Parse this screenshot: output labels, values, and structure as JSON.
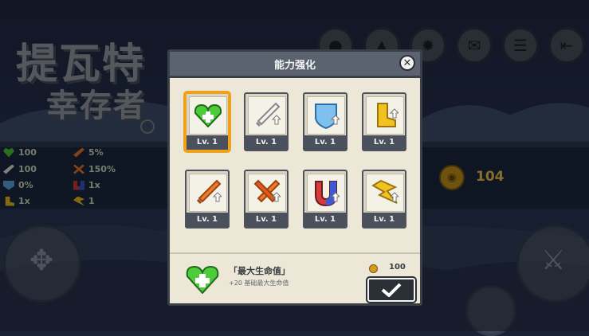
{
  "logo": {
    "line1": "提瓦特",
    "line2": "幸存者"
  },
  "top_icons": [
    "avatar-icon",
    "upload-icon",
    "gear-icon",
    "mail-icon",
    "list-icon",
    "exit-icon"
  ],
  "stats": [
    {
      "icon": "heart-icon",
      "value": "100",
      "color": "#4ecb3a"
    },
    {
      "icon": "sword-icon",
      "value": "100",
      "color": "#e9e9e9"
    },
    {
      "icon": "shield-icon",
      "value": "0%",
      "color": "#5aa8e6"
    },
    {
      "icon": "boot-icon",
      "value": "1x",
      "color": "#f2c21f"
    },
    {
      "icon": "crit-icon",
      "value": "5%",
      "color": "#f07a2a"
    },
    {
      "icon": "crit-damage-icon",
      "value": "150%",
      "color": "#f07a2a"
    },
    {
      "icon": "magnet-icon",
      "value": "1x",
      "color": "#d63a3a"
    },
    {
      "icon": "dash-icon",
      "value": "1",
      "color": "#f2c21f"
    }
  ],
  "currency": {
    "value": "104"
  },
  "panel": {
    "title": "能力强化",
    "cards": [
      {
        "icon": "heart-plus-icon",
        "level": "Lv. 1"
      },
      {
        "icon": "sword-up-icon",
        "level": "Lv. 1"
      },
      {
        "icon": "shield-up-icon",
        "level": "Lv. 1"
      },
      {
        "icon": "boot-up-icon",
        "level": "Lv. 1"
      },
      {
        "icon": "sword-orange-up-icon",
        "level": "Lv. 1"
      },
      {
        "icon": "crossed-swords-up-icon",
        "level": "Lv. 1"
      },
      {
        "icon": "magnet-up-icon",
        "level": "Lv. 1"
      },
      {
        "icon": "dash-up-icon",
        "level": "Lv. 1"
      }
    ],
    "selected_title": "「最大生命值」",
    "selected_desc": "+20 基础最大生命值",
    "cost": "100"
  },
  "colors": {
    "accent_selected": "#f0a21d",
    "coin": "#f3c948"
  }
}
